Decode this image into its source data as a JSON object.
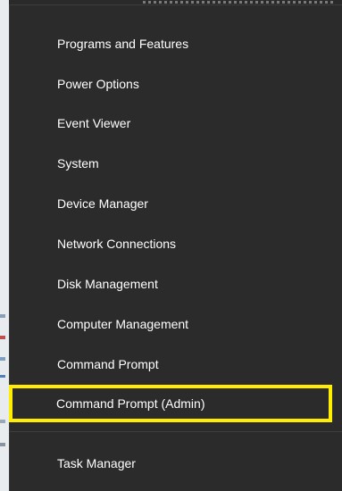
{
  "menu": {
    "items": [
      {
        "label": "Programs and Features"
      },
      {
        "label": "Power Options"
      },
      {
        "label": "Event Viewer"
      },
      {
        "label": "System"
      },
      {
        "label": "Device Manager"
      },
      {
        "label": "Network Connections"
      },
      {
        "label": "Disk Management"
      },
      {
        "label": "Computer Management"
      },
      {
        "label": "Command Prompt"
      },
      {
        "label": "Command Prompt (Admin)",
        "highlighted": true
      },
      {
        "label": "Task Manager"
      }
    ],
    "highlight_color": "#ffee00",
    "background_color": "#2b2b2b"
  }
}
